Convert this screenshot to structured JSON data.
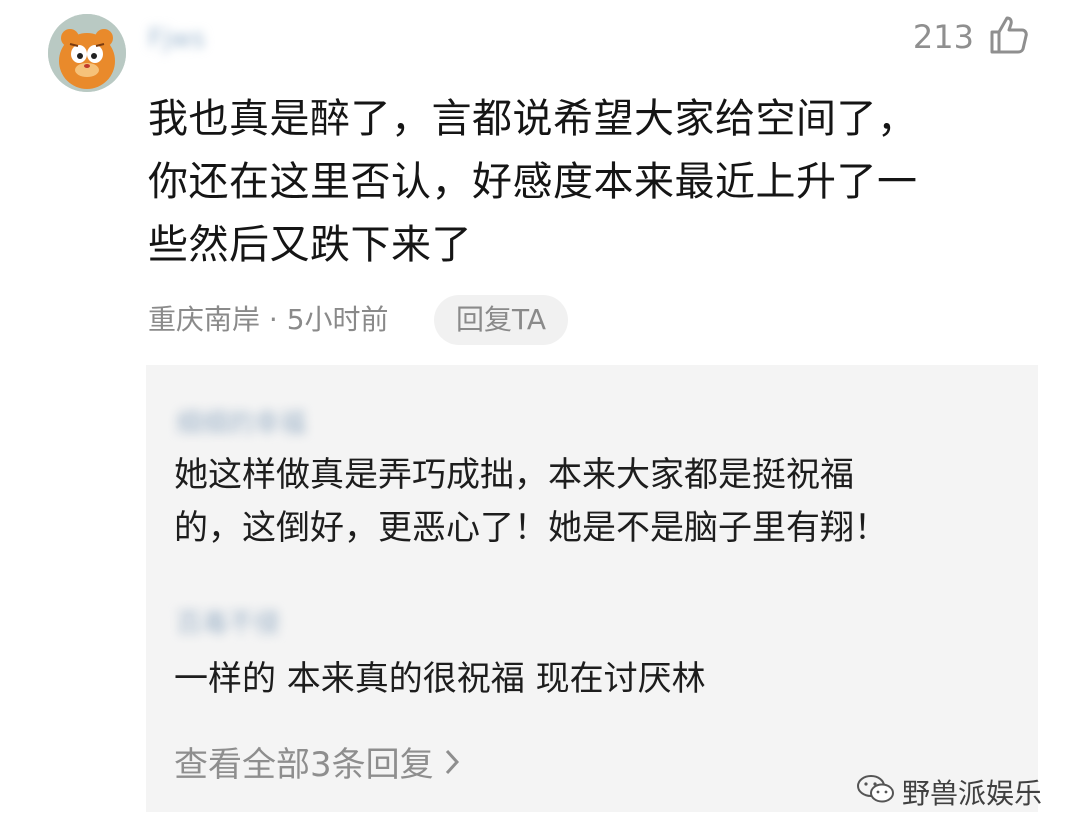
{
  "comment": {
    "username": "Fjws",
    "likes": "213",
    "text_lines": [
      "我也真是醉了，言都说希望大家给空间了，",
      "你还在这里否认，好感度本来最近上升了一",
      "些然后又跌下来了"
    ],
    "meta": "重庆南岸 · 5小时前",
    "reply_button": "回复TA"
  },
  "replies": [
    {
      "author": "细细的幸福",
      "text_lines": [
        "她这样做真是弄巧成拙，本来大家都是挺祝福",
        "的，这倒好，更恶心了！她是不是脑子里有翔！"
      ]
    },
    {
      "author": "百毒不侵",
      "text_lines": [
        "一样的 本来真的很祝福 现在讨厌林"
      ]
    }
  ],
  "view_all": "查看全部3条回复",
  "watermark": "野兽派娱乐",
  "icons": {
    "like": "thumbs-up-icon",
    "chevron": "chevron-right-icon",
    "watermark": "wechat-icon"
  },
  "colors": {
    "primary_text": "#151515",
    "secondary_text": "#8a8a8a",
    "reply_bg": "#f4f4f4"
  }
}
